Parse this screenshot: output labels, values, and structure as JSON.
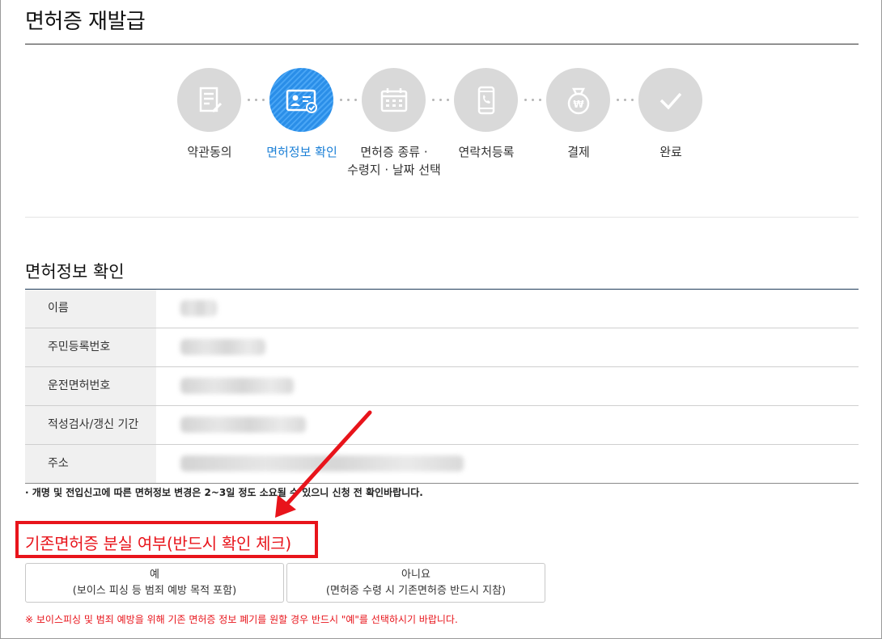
{
  "page": {
    "title": "면허증 재발급"
  },
  "stepper": {
    "steps": [
      {
        "label": "약관동의",
        "icon": "document-edit-icon",
        "active": false
      },
      {
        "label": "면허정보 확인",
        "icon": "id-card-check-icon",
        "active": true
      },
      {
        "label": "면허증 종류 · 수령지 · 날짜 선택",
        "icon": "calendar-icon",
        "active": false
      },
      {
        "label": "연락처등록",
        "icon": "phone-icon",
        "active": false
      },
      {
        "label": "결제",
        "icon": "won-bag-icon",
        "active": false
      },
      {
        "label": "완료",
        "icon": "check-icon",
        "active": false
      }
    ],
    "label_line1_3": "면허증 종류 ·",
    "label_line2_3": "수령지 · 날짜 선택",
    "colors": {
      "active": "#2a8ee8",
      "inactive": "#d9d9d9"
    }
  },
  "section": {
    "title": "면허정보 확인",
    "rows": [
      {
        "label": "이름"
      },
      {
        "label": "주민등록번호"
      },
      {
        "label": "운전면허번호"
      },
      {
        "label": "적성검사/갱신 기간"
      },
      {
        "label": "주소"
      }
    ],
    "notice": "· 개명 및 전입신고에 따른 면허정보 변경은 2~3일 정도 소요될 수 있으니 신청 전 확인바랍니다."
  },
  "loss": {
    "title": "기존면허증 분실 여부(반드시 확인 체크)",
    "yes": {
      "label": "예",
      "sub": "(보이스 피싱 등 범죄 예방 목적 포함)"
    },
    "no": {
      "label": "아니요",
      "sub": "(면허증 수령 시 기존면허증 반드시 지참)"
    },
    "warning": "※ 보이스피싱 및 범죄 예방을 위해 기존 면허증 정보 폐기를 원할 경우 반드시 \"예\"를 선택하시기 바랍니다.",
    "accent_color": "#e8141b"
  }
}
